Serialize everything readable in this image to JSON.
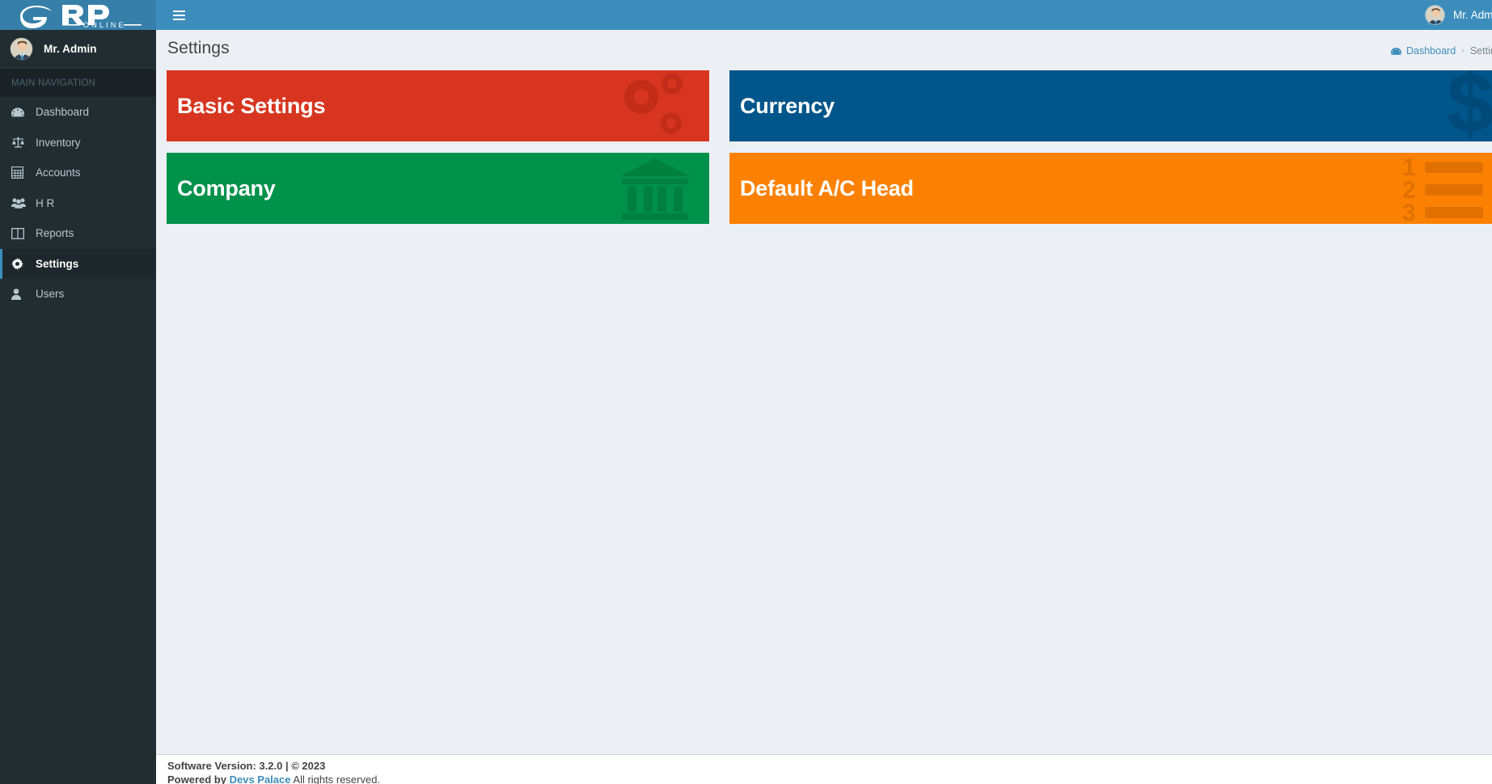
{
  "brand": {
    "logo_text": "RP",
    "logo_sub": "ONLINE",
    "logo_mark": "e-swoosh-logo"
  },
  "sidebar": {
    "user": {
      "name": "Mr. Admin",
      "avatar": "user-avatar"
    },
    "nav_header": "MAIN NAVIGATION",
    "items": [
      {
        "label": "Dashboard",
        "icon": "dashboard-icon",
        "active": false
      },
      {
        "label": "Inventory",
        "icon": "balance-scale-icon",
        "active": false
      },
      {
        "label": "Accounts",
        "icon": "calculator-icon",
        "active": false
      },
      {
        "label": "H R",
        "icon": "users-group-icon",
        "active": false
      },
      {
        "label": "Reports",
        "icon": "columns-icon",
        "active": false
      },
      {
        "label": "Settings",
        "icon": "gear-icon",
        "active": true
      },
      {
        "label": "Users",
        "icon": "user-icon",
        "active": false
      }
    ]
  },
  "header": {
    "menu_toggle": "hamburger-icon",
    "user_name": "Mr. Admin"
  },
  "content": {
    "page_title": "Settings",
    "breadcrumb": {
      "home_label": "Dashboard",
      "home_icon": "dashboard-icon",
      "separator": "›",
      "current": "Settings"
    },
    "cards": [
      {
        "title": "Basic Settings",
        "color": "#d7351f",
        "icon_color": "#c22c19",
        "icon": "gears-icon",
        "column": "left"
      },
      {
        "title": "Currency",
        "color": "#00558b",
        "icon_color": "#004a79",
        "icon": "dollar-sign-icon",
        "column": "right"
      },
      {
        "title": "Company",
        "color": "#00914b",
        "icon_color": "#00803f",
        "icon": "bank-icon",
        "column": "left"
      },
      {
        "title": "Default A/C Head",
        "color": "#fc8102",
        "icon_color": "#e07100",
        "icon": "numbered-list-icon",
        "column": "right"
      }
    ]
  },
  "footer": {
    "version_line": "Software Version: 3.2.0 | © 2023",
    "powered_prefix": "Powered by",
    "powered_link": "Devs Palace",
    "powered_suffix": "All rights reserved."
  },
  "colors": {
    "header_blue": "#3c8dbc",
    "sidebar_dark": "#222d32",
    "content_bg": "#ecf0f5",
    "link_blue": "#3c8dbc"
  }
}
